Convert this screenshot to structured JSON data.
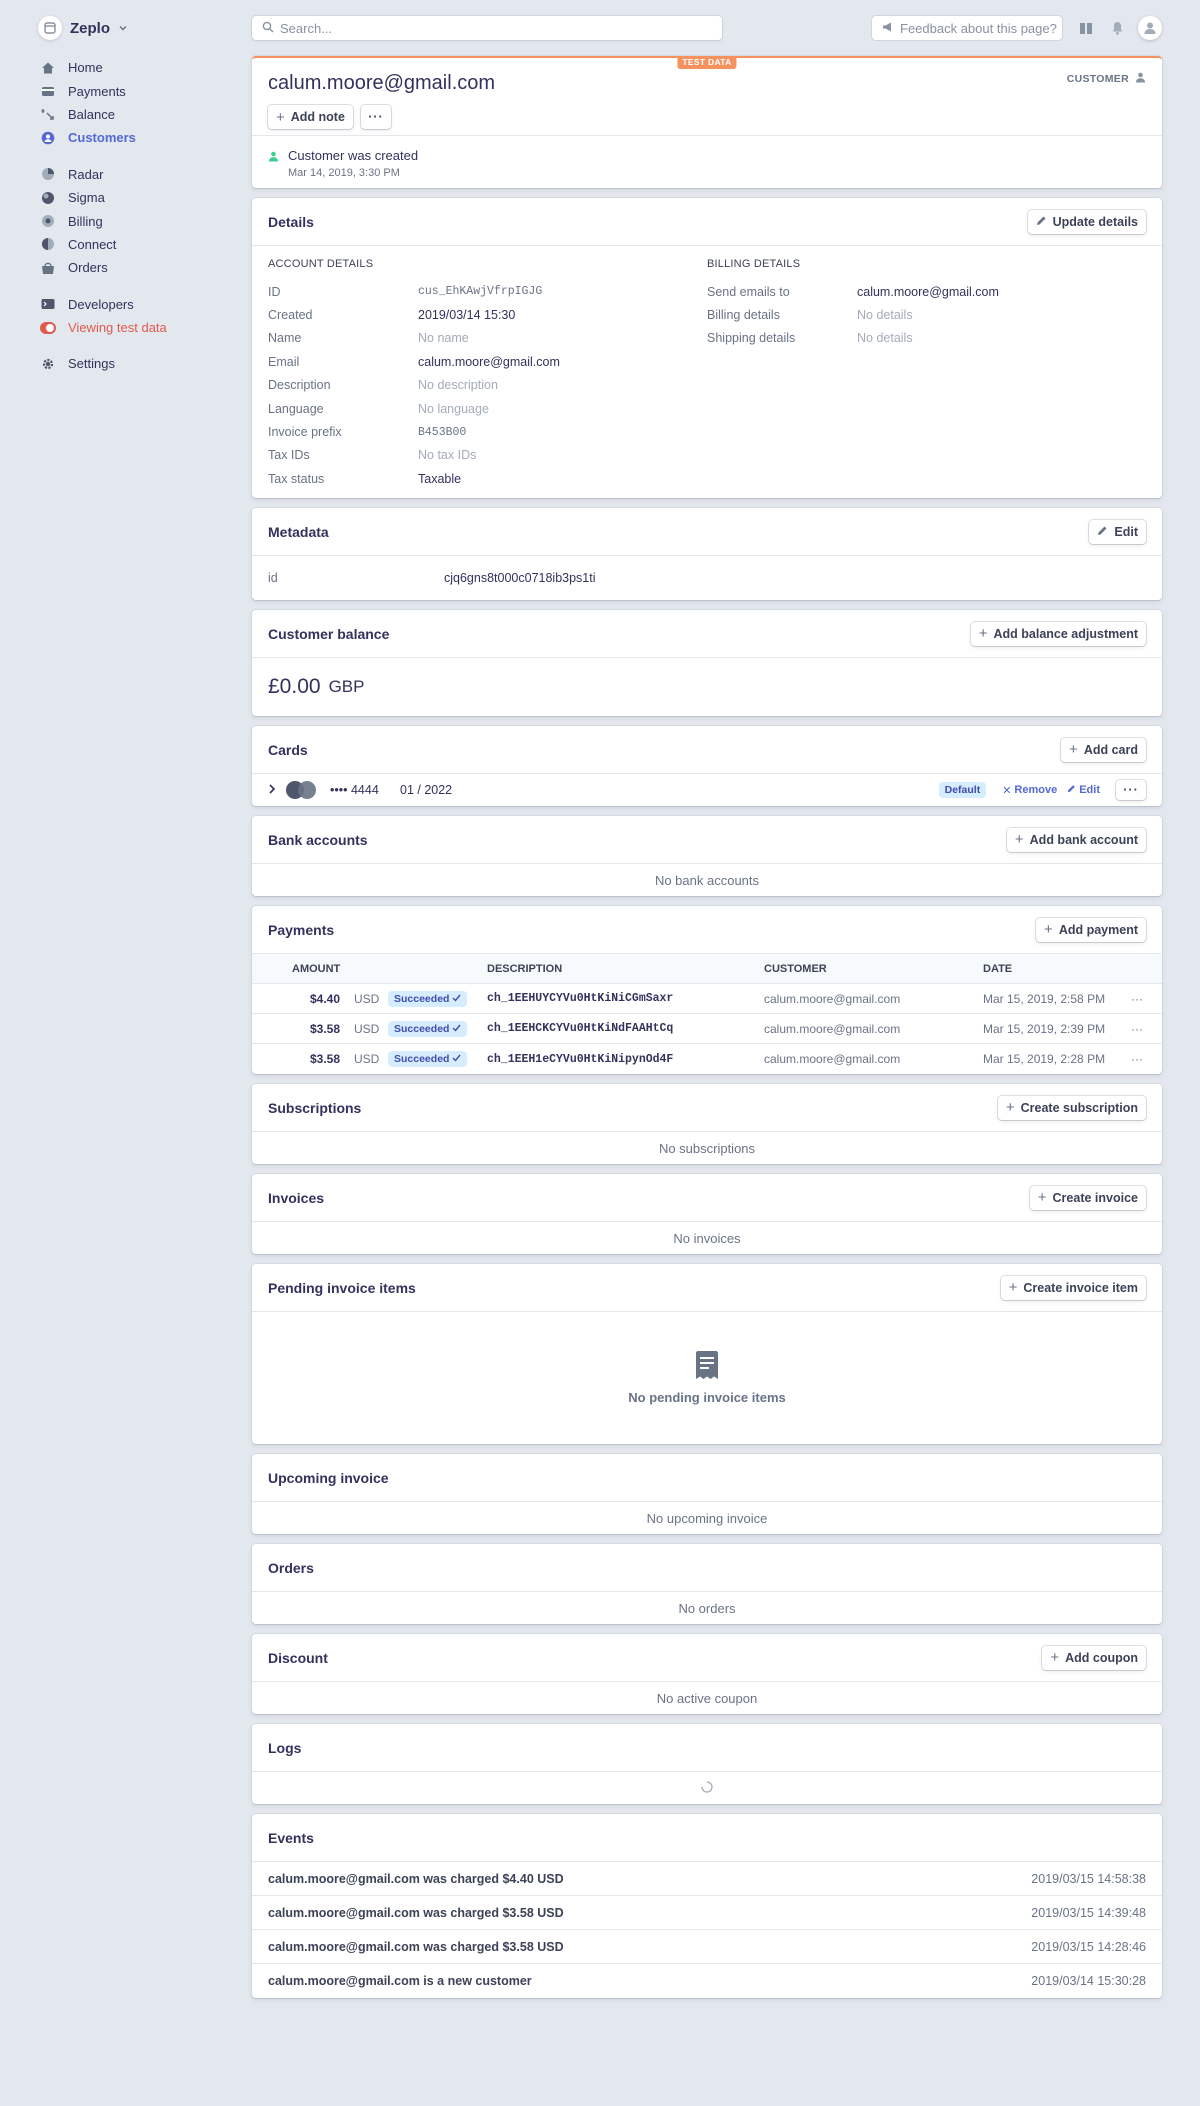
{
  "app": {
    "name": "Zeplo"
  },
  "search": {
    "placeholder": "Search..."
  },
  "feedback": {
    "placeholder": "Feedback about this page?"
  },
  "sidebar": {
    "groups": [
      [
        {
          "label": "Home",
          "icon": "home-icon"
        },
        {
          "label": "Payments",
          "icon": "payments-icon"
        },
        {
          "label": "Balance",
          "icon": "balance-icon"
        },
        {
          "label": "Customers",
          "icon": "customers-icon",
          "active": true
        }
      ],
      [
        {
          "label": "Radar",
          "icon": "radar-icon"
        },
        {
          "label": "Sigma",
          "icon": "sigma-icon"
        },
        {
          "label": "Billing",
          "icon": "billing-icon"
        },
        {
          "label": "Connect",
          "icon": "connect-icon"
        },
        {
          "label": "Orders",
          "icon": "orders-icon"
        }
      ],
      [
        {
          "label": "Developers",
          "icon": "developers-icon"
        },
        {
          "label": "Viewing test data",
          "icon": "toggle-icon"
        }
      ],
      [
        {
          "label": "Settings",
          "icon": "gear-icon"
        }
      ]
    ]
  },
  "customer": {
    "test_badge": "TEST DATA",
    "email": "calum.moore@gmail.com",
    "label": "CUSTOMER",
    "add_note": "Add note",
    "more": "···",
    "timeline": {
      "title": "Customer was created",
      "date": "Mar 14, 2019, 3:30 PM"
    }
  },
  "details": {
    "title": "Details",
    "update": "Update details",
    "account_heading": "ACCOUNT DETAILS",
    "billing_heading": "BILLING DETAILS",
    "account": [
      {
        "k": "ID",
        "v": "cus_EhKAwjVfrpIGJG",
        "style": "mono"
      },
      {
        "k": "Created",
        "v": "2019/03/14 15:30",
        "style": ""
      },
      {
        "k": "Name",
        "v": "No name",
        "style": "muted"
      },
      {
        "k": "Email",
        "v": "calum.moore@gmail.com",
        "style": ""
      },
      {
        "k": "Description",
        "v": "No description",
        "style": "muted"
      },
      {
        "k": "Language",
        "v": "No language",
        "style": "muted"
      },
      {
        "k": "Invoice prefix",
        "v": "B453B00",
        "style": "mono"
      },
      {
        "k": "Tax IDs",
        "v": "No tax IDs",
        "style": "muted"
      },
      {
        "k": "Tax status",
        "v": "Taxable",
        "style": ""
      }
    ],
    "billing": [
      {
        "k": "Send emails to",
        "v": "calum.moore@gmail.com",
        "style": ""
      },
      {
        "k": "Billing details",
        "v": "No details",
        "style": "muted"
      },
      {
        "k": "Shipping details",
        "v": "No details",
        "style": "muted"
      }
    ]
  },
  "metadata": {
    "title": "Metadata",
    "edit": "Edit",
    "key": "id",
    "value": "cjq6gns8t000c0718ib3ps1ti"
  },
  "balance": {
    "title": "Customer balance",
    "add": "Add balance adjustment",
    "amount": "£0.00",
    "currency": "GBP"
  },
  "cards": {
    "title": "Cards",
    "add": "Add card",
    "items": [
      {
        "brand": "MasterCard",
        "last4": "•••• 4444",
        "exp": "01 / 2022",
        "badge": "Default",
        "remove": "Remove",
        "edit": "Edit"
      }
    ]
  },
  "bank": {
    "title": "Bank accounts",
    "add": "Add bank account",
    "empty": "No bank accounts"
  },
  "payments": {
    "title": "Payments",
    "add": "Add payment",
    "columns": [
      "AMOUNT",
      "DESCRIPTION",
      "CUSTOMER",
      "DATE"
    ],
    "rows": [
      {
        "amount": "$4.40",
        "currency": "USD",
        "status": "Succeeded",
        "desc": "ch_1EEHUYCYVu0HtKiNiCGmSaxr",
        "customer": "calum.moore@gmail.com",
        "date": "Mar 15, 2019, 2:58 PM"
      },
      {
        "amount": "$3.58",
        "currency": "USD",
        "status": "Succeeded",
        "desc": "ch_1EEHCKCYVu0HtKiNdFAAHtCq",
        "customer": "calum.moore@gmail.com",
        "date": "Mar 15, 2019, 2:39 PM"
      },
      {
        "amount": "$3.58",
        "currency": "USD",
        "status": "Succeeded",
        "desc": "ch_1EEH1eCYVu0HtKiNipynOd4F",
        "customer": "calum.moore@gmail.com",
        "date": "Mar 15, 2019, 2:28 PM"
      }
    ]
  },
  "subscriptions": {
    "title": "Subscriptions",
    "add": "Create subscription",
    "empty": "No subscriptions"
  },
  "invoices": {
    "title": "Invoices",
    "add": "Create invoice",
    "empty": "No invoices"
  },
  "pending": {
    "title": "Pending invoice items",
    "add": "Create invoice item",
    "empty": "No pending invoice items"
  },
  "upcoming": {
    "title": "Upcoming invoice",
    "empty": "No upcoming invoice"
  },
  "orders": {
    "title": "Orders",
    "empty": "No orders"
  },
  "discount": {
    "title": "Discount",
    "add": "Add coupon",
    "empty": "No active coupon"
  },
  "logs": {
    "title": "Logs"
  },
  "events": {
    "title": "Events",
    "items": [
      {
        "text": "calum.moore@gmail.com was charged $4.40 USD",
        "time": "2019/03/15 14:58:38"
      },
      {
        "text": "calum.moore@gmail.com was charged $3.58 USD",
        "time": "2019/03/15 14:39:48"
      },
      {
        "text": "calum.moore@gmail.com was charged $3.58 USD",
        "time": "2019/03/15 14:28:46"
      },
      {
        "text": "calum.moore@gmail.com is a new customer",
        "time": "2019/03/14 15:30:28"
      }
    ]
  },
  "colors": {
    "accent": "#5469d4",
    "test": "#e25950",
    "test_badge": "#f5925e",
    "success": "#3ecf8e"
  }
}
